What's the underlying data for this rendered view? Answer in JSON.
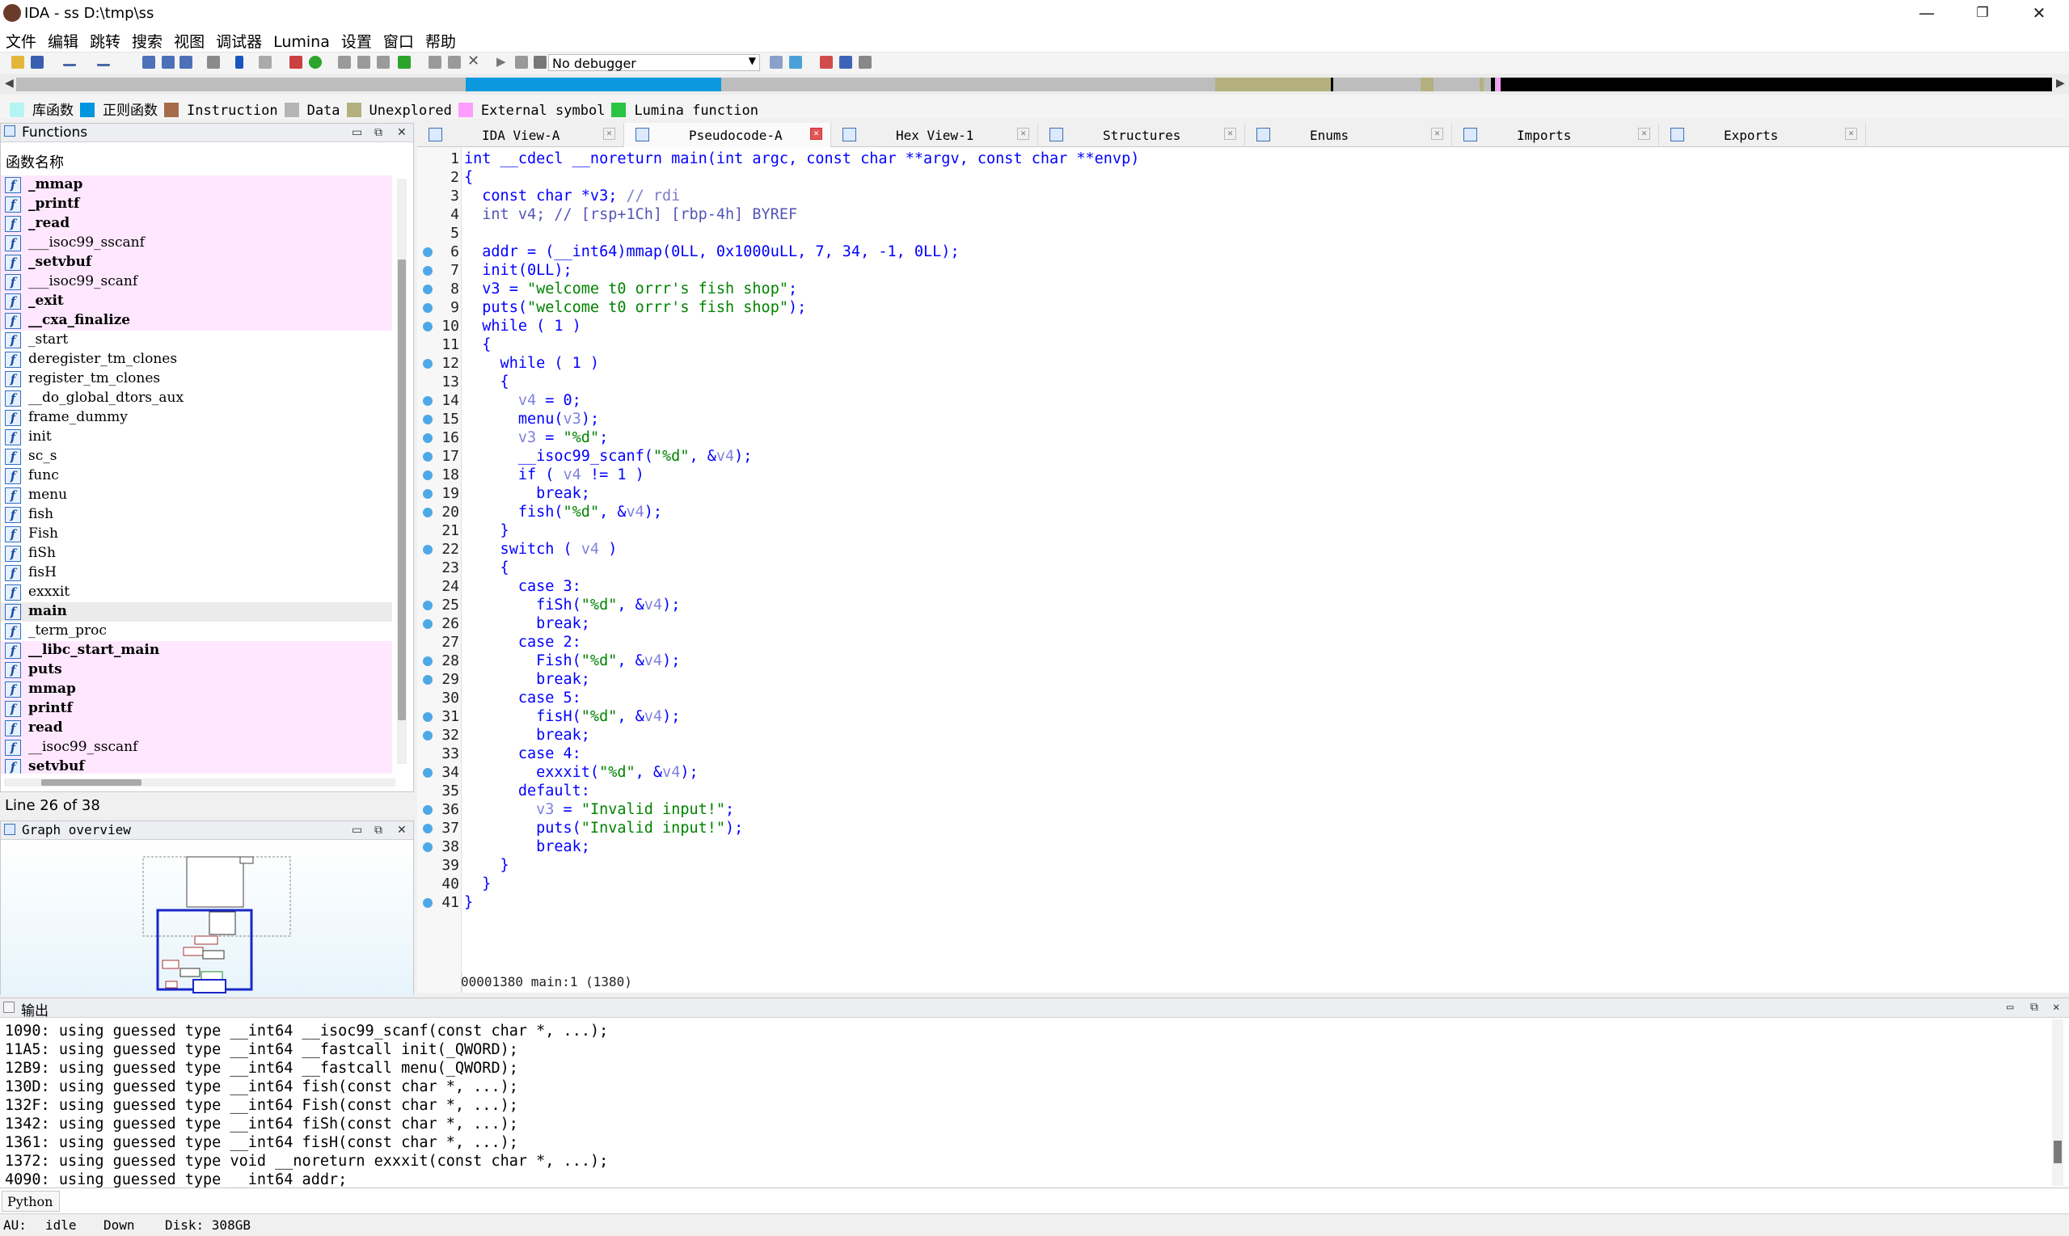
{
  "window": {
    "title": "IDA - ss D:\\tmp\\ss",
    "min": "—",
    "max": "❐",
    "close": "✕"
  },
  "menu": [
    "文件",
    "编辑",
    "跳转",
    "搜索",
    "视图",
    "调试器",
    "Lumina",
    "设置",
    "窗口",
    "帮助"
  ],
  "toolbar": {
    "debugger": "No debugger"
  },
  "legend": [
    {
      "label": "库函数",
      "color": "#b6f4f4"
    },
    {
      "label": "正则函数",
      "color": "#0095de"
    },
    {
      "label": "Instruction",
      "color": "#a66b4a"
    },
    {
      "label": "Data",
      "color": "#b5b5b5"
    },
    {
      "label": "Unexplored",
      "color": "#b4b07e"
    },
    {
      "label": "External symbol",
      "color": "#ff9cff"
    },
    {
      "label": "Lumina function",
      "color": "#29c443"
    }
  ],
  "functions": {
    "title": "Functions",
    "column": "函数名称",
    "items": [
      {
        "name": "_mmap",
        "bold": true,
        "pink": true
      },
      {
        "name": "_printf",
        "bold": true,
        "pink": true
      },
      {
        "name": "_read",
        "bold": true,
        "pink": true
      },
      {
        "name": "___isoc99_sscanf",
        "bold": false,
        "pink": true
      },
      {
        "name": "_setvbuf",
        "bold": true,
        "pink": true
      },
      {
        "name": "___isoc99_scanf",
        "bold": false,
        "pink": true
      },
      {
        "name": "_exit",
        "bold": true,
        "pink": true
      },
      {
        "name": "__cxa_finalize",
        "bold": true,
        "pink": true
      },
      {
        "name": "_start",
        "bold": false,
        "pink": false
      },
      {
        "name": "deregister_tm_clones",
        "bold": false,
        "pink": false
      },
      {
        "name": "register_tm_clones",
        "bold": false,
        "pink": false
      },
      {
        "name": "__do_global_dtors_aux",
        "bold": false,
        "pink": false
      },
      {
        "name": "frame_dummy",
        "bold": false,
        "pink": false
      },
      {
        "name": "init",
        "bold": false,
        "pink": false
      },
      {
        "name": "sc_s",
        "bold": false,
        "pink": false
      },
      {
        "name": "func",
        "bold": false,
        "pink": false
      },
      {
        "name": "menu",
        "bold": false,
        "pink": false
      },
      {
        "name": "fish",
        "bold": false,
        "pink": false
      },
      {
        "name": "Fish",
        "bold": false,
        "pink": false
      },
      {
        "name": "fiSh",
        "bold": false,
        "pink": false
      },
      {
        "name": "fisH",
        "bold": false,
        "pink": false
      },
      {
        "name": "exxxit",
        "bold": false,
        "pink": false
      },
      {
        "name": "main",
        "bold": true,
        "pink": false,
        "selected": true
      },
      {
        "name": "_term_proc",
        "bold": false,
        "pink": false
      },
      {
        "name": "__libc_start_main",
        "bold": true,
        "pink": true
      },
      {
        "name": "puts",
        "bold": true,
        "pink": true
      },
      {
        "name": "mmap",
        "bold": true,
        "pink": true
      },
      {
        "name": "printf",
        "bold": true,
        "pink": true
      },
      {
        "name": "read",
        "bold": true,
        "pink": true
      },
      {
        "name": "__isoc99_sscanf",
        "bold": false,
        "pink": true
      },
      {
        "name": "setvbuf",
        "bold": true,
        "pink": true
      }
    ],
    "footer": "Line 26 of 38"
  },
  "graph": {
    "title": "Graph overview"
  },
  "tabs": [
    {
      "label": "IDA View-A",
      "closeRed": false
    },
    {
      "label": "Pseudocode-A",
      "closeRed": true,
      "active": true
    },
    {
      "label": "Hex View-1",
      "closeRed": false
    },
    {
      "label": "Structures",
      "closeRed": false
    },
    {
      "label": "Enums",
      "closeRed": false
    },
    {
      "label": "Imports",
      "closeRed": false
    },
    {
      "label": "Exports",
      "closeRed": false
    }
  ],
  "code": [
    {
      "n": "1",
      "dot": false,
      "html": "int __cdecl __noreturn main(int argc, const char **argv, const char **envp)"
    },
    {
      "n": "2",
      "dot": false,
      "html": "{"
    },
    {
      "n": "3",
      "dot": false,
      "html": "  const char *v3; <span class=\"cm\">// rdi</span>"
    },
    {
      "n": "4",
      "dot": false,
      "html": "  <span class=\"gr\">int v4; // [rsp+1Ch] [rbp-4h] BYREF</span>"
    },
    {
      "n": "5",
      "dot": false,
      "html": ""
    },
    {
      "n": "6",
      "dot": true,
      "html": "  addr = (__int64)mmap(0LL, 0x1000uLL, 7, 34, -1, 0LL);"
    },
    {
      "n": "7",
      "dot": true,
      "html": "  init(0LL);"
    },
    {
      "n": "8",
      "dot": true,
      "html": "  v3 = <span class=\"st\">\"welcome t0 orrr's fish shop\"</span>;"
    },
    {
      "n": "9",
      "dot": true,
      "html": "  puts(<span class=\"st\">\"welcome t0 orrr's fish shop\"</span>);"
    },
    {
      "n": "10",
      "dot": true,
      "html": "  while ( 1 )"
    },
    {
      "n": "11",
      "dot": false,
      "html": "  {"
    },
    {
      "n": "12",
      "dot": true,
      "html": "    while ( 1 )"
    },
    {
      "n": "13",
      "dot": false,
      "html": "    {"
    },
    {
      "n": "14",
      "dot": true,
      "html": "      <span class=\"vr\">v4</span> = 0;"
    },
    {
      "n": "15",
      "dot": true,
      "html": "      menu(<span class=\"vr\">v3</span>);"
    },
    {
      "n": "16",
      "dot": true,
      "html": "      <span class=\"vr\">v3</span> = <span class=\"st\">\"%d\"</span>;"
    },
    {
      "n": "17",
      "dot": true,
      "html": "      __isoc99_scanf(<span class=\"st\">\"%d\"</span>, &amp;<span class=\"vr\">v4</span>);"
    },
    {
      "n": "18",
      "dot": true,
      "html": "      if ( <span class=\"vr\">v4</span> != 1 )"
    },
    {
      "n": "19",
      "dot": true,
      "html": "        break;"
    },
    {
      "n": "20",
      "dot": true,
      "html": "      fish(<span class=\"st\">\"%d\"</span>, &amp;<span class=\"vr\">v4</span>);"
    },
    {
      "n": "21",
      "dot": false,
      "html": "    }"
    },
    {
      "n": "22",
      "dot": true,
      "html": "    switch ( <span class=\"vr\">v4</span> )"
    },
    {
      "n": "23",
      "dot": false,
      "html": "    {"
    },
    {
      "n": "24",
      "dot": false,
      "html": "      case 3:"
    },
    {
      "n": "25",
      "dot": true,
      "html": "        fiSh(<span class=\"st\">\"%d\"</span>, &amp;<span class=\"vr\">v4</span>);"
    },
    {
      "n": "26",
      "dot": true,
      "html": "        break;"
    },
    {
      "n": "27",
      "dot": false,
      "html": "      case 2:"
    },
    {
      "n": "28",
      "dot": true,
      "html": "        Fish(<span class=\"st\">\"%d\"</span>, &amp;<span class=\"vr\">v4</span>);"
    },
    {
      "n": "29",
      "dot": true,
      "html": "        break;"
    },
    {
      "n": "30",
      "dot": false,
      "html": "      case 5:"
    },
    {
      "n": "31",
      "dot": true,
      "html": "        fisH(<span class=\"st\">\"%d\"</span>, &amp;<span class=\"vr\">v4</span>);"
    },
    {
      "n": "32",
      "dot": true,
      "html": "        break;"
    },
    {
      "n": "33",
      "dot": false,
      "html": "      case 4:"
    },
    {
      "n": "34",
      "dot": true,
      "html": "        exxxit(<span class=\"st\">\"%d\"</span>, &amp;<span class=\"vr\">v4</span>);"
    },
    {
      "n": "35",
      "dot": false,
      "html": "      default:"
    },
    {
      "n": "36",
      "dot": true,
      "html": "        <span class=\"vr\">v3</span> = <span class=\"st\">\"Invalid input!\"</span>;"
    },
    {
      "n": "37",
      "dot": true,
      "html": "        puts(<span class=\"st\">\"Invalid input!\"</span>);"
    },
    {
      "n": "38",
      "dot": true,
      "html": "        break;"
    },
    {
      "n": "39",
      "dot": false,
      "html": "    }"
    },
    {
      "n": "40",
      "dot": false,
      "html": "  }"
    },
    {
      "n": "41",
      "dot": true,
      "html": "}"
    }
  ],
  "editor_status": "00001380 main:1 (1380)",
  "output": {
    "title": "输出",
    "lines": [
      "1090: using guessed type __int64 __isoc99_scanf(const char *, ...);",
      "11A5: using guessed type __int64 __fastcall init(_QWORD);",
      "12B9: using guessed type __int64 __fastcall menu(_QWORD);",
      "130D: using guessed type __int64 fish(const char *, ...);",
      "132F: using guessed type __int64 Fish(const char *, ...);",
      "1342: using guessed type __int64 fiSh(const char *, ...);",
      "1361: using guessed type __int64 fisH(const char *, ...);",
      "1372: using guessed type void __noreturn exxxit(const char *, ...);",
      "4090: using guessed type __int64 addr;"
    ]
  },
  "python": {
    "label": "Python"
  },
  "statusbar": {
    "au": "AU:",
    "state": "idle",
    "dir": "Down",
    "disk": "Disk: 308GB"
  }
}
